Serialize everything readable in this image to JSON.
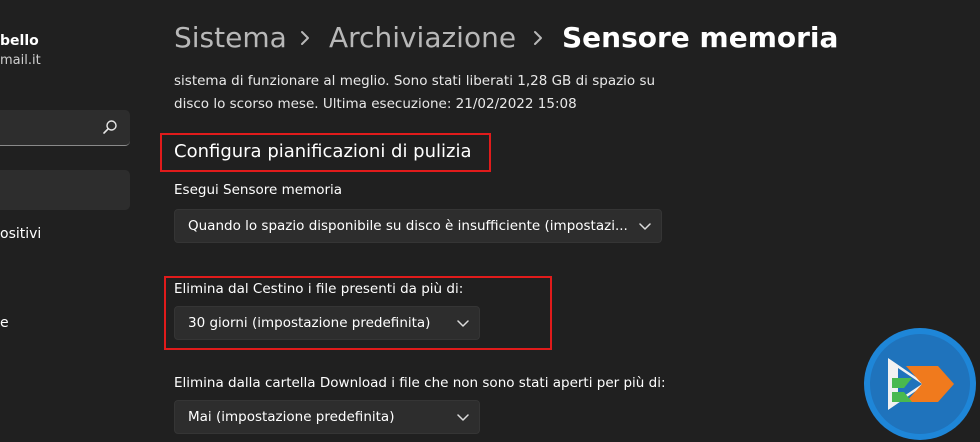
{
  "account": {
    "name": "bello",
    "email": "mail.it"
  },
  "sidebar": {
    "search_placeholder": "",
    "items": [
      "ositivi",
      "e"
    ]
  },
  "breadcrumb": [
    "Sistema",
    "Archiviazione",
    "Sensore memoria"
  ],
  "description": "sistema di funzionare al meglio. Sono stati liberati 1,28 GB di spazio su disco lo scorso mese. Ultima esecuzione: 21/02/2022 15:08",
  "section_title": "Configura pianificazioni di pulizia",
  "settings": {
    "run_label": "Esegui Sensore memoria",
    "run_value": "Quando lo spazio disponibile su disco è insufficiente (impostazi...",
    "recycle_label": "Elimina dal Cestino i file presenti da più di:",
    "recycle_value": "30 giorni (impostazione predefinita)",
    "downloads_label": "Elimina dalla cartella Download i file che non sono stati aperti per più di:",
    "downloads_value": "Mai (impostazione predefinita)"
  },
  "colors": {
    "background": "#202020",
    "highlight": "#e01b1b",
    "logo_blue": "#1e86d8"
  },
  "icons": {
    "search": "search-icon",
    "chevron": "chevron-down-icon",
    "logo": "logo-icon"
  }
}
